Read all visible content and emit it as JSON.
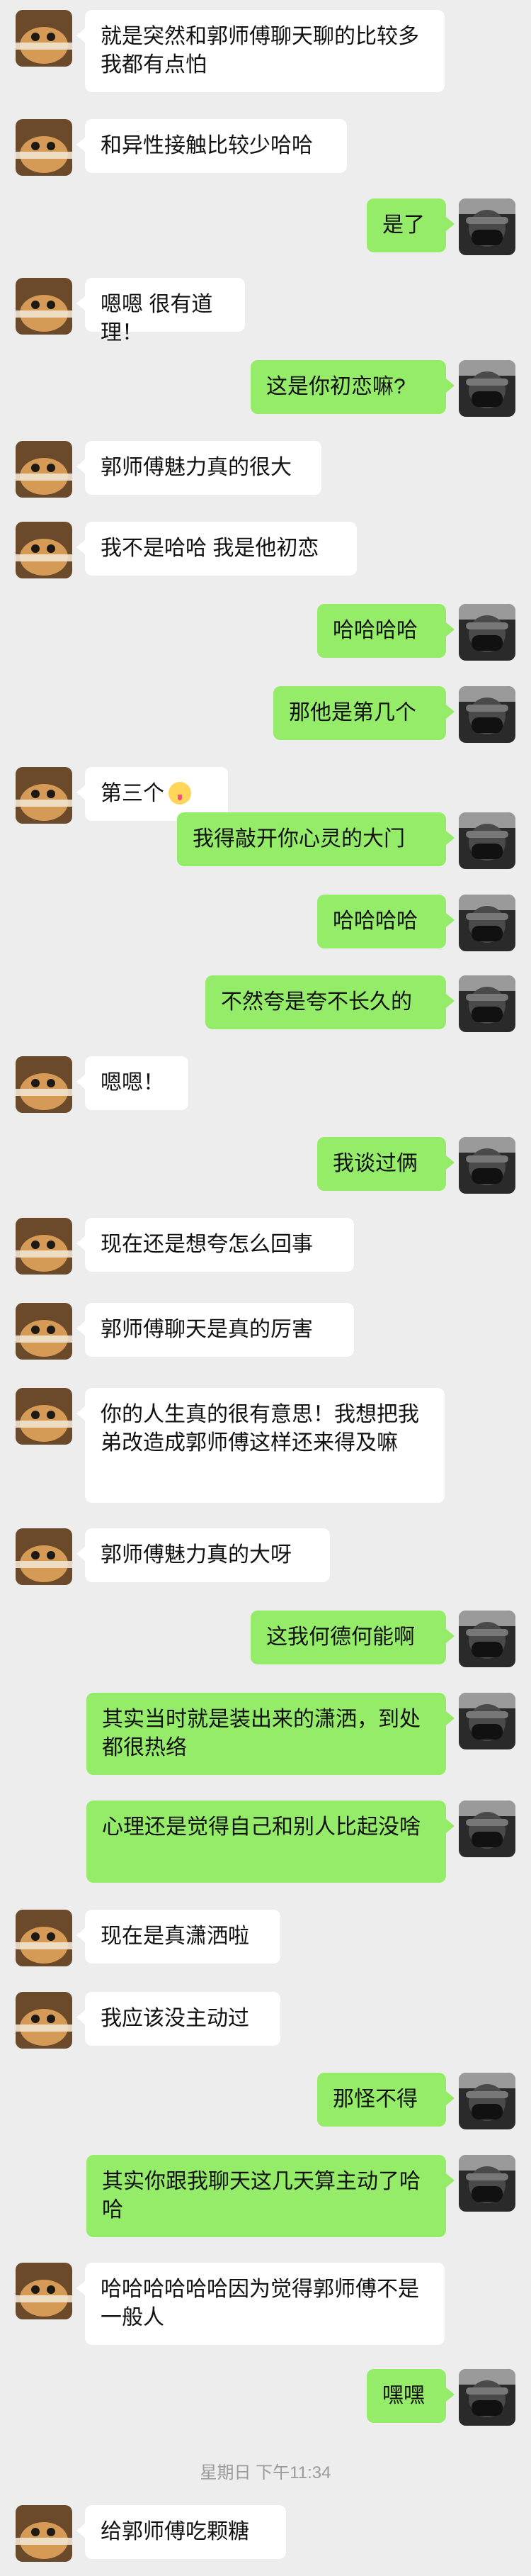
{
  "chat": {
    "timestamp": "星期日 下午11:34",
    "messages": [
      {
        "side": "left",
        "text": "就是突然和郭师傅聊天聊的比较多 我都有点怕"
      },
      {
        "side": "left",
        "text": "和异性接触比较少哈哈"
      },
      {
        "side": "right",
        "text": "是了"
      },
      {
        "side": "left",
        "text": "嗯嗯 很有道理！"
      },
      {
        "side": "right",
        "text": "这是你初恋嘛?"
      },
      {
        "side": "left",
        "text": "郭师傅魅力真的很大"
      },
      {
        "side": "left",
        "text": "我不是哈哈 我是他初恋"
      },
      {
        "side": "right",
        "text": "哈哈哈哈"
      },
      {
        "side": "right",
        "text": "那他是第几个"
      },
      {
        "side": "left",
        "text": "第三个",
        "emoji": "tongue-emoji"
      },
      {
        "side": "right",
        "text": "我得敲开你心灵的大门"
      },
      {
        "side": "right",
        "text": "哈哈哈哈"
      },
      {
        "side": "right",
        "text": "不然夸是夸不长久的"
      },
      {
        "side": "left",
        "text": "嗯嗯！"
      },
      {
        "side": "right",
        "text": "我谈过俩"
      },
      {
        "side": "left",
        "text": "现在还是想夸怎么回事"
      },
      {
        "side": "left",
        "text": "郭师傅聊天是真的厉害"
      },
      {
        "side": "left",
        "text": "你的人生真的很有意思！我想把我弟改造成郭师傅这样还来得及嘛"
      },
      {
        "side": "left",
        "text": "郭师傅魅力真的大呀"
      },
      {
        "side": "right",
        "text": "这我何德何能啊"
      },
      {
        "side": "right",
        "text": "其实当时就是装出来的潇洒，到处都很热络"
      },
      {
        "side": "right",
        "text": "心理还是觉得自己和别人比起没啥"
      },
      {
        "side": "left",
        "text": "现在是真潇洒啦"
      },
      {
        "side": "left",
        "text": "我应该没主动过"
      },
      {
        "side": "right",
        "text": "那怪不得"
      },
      {
        "side": "right",
        "text": "其实你跟我聊天这几天算主动了哈哈"
      },
      {
        "side": "left",
        "text": "哈哈哈哈哈哈因为觉得郭师傅不是一般人"
      },
      {
        "side": "right",
        "text": "嘿嘿"
      },
      {
        "side": "left",
        "text": "给郭师傅吃颗糖"
      }
    ]
  }
}
